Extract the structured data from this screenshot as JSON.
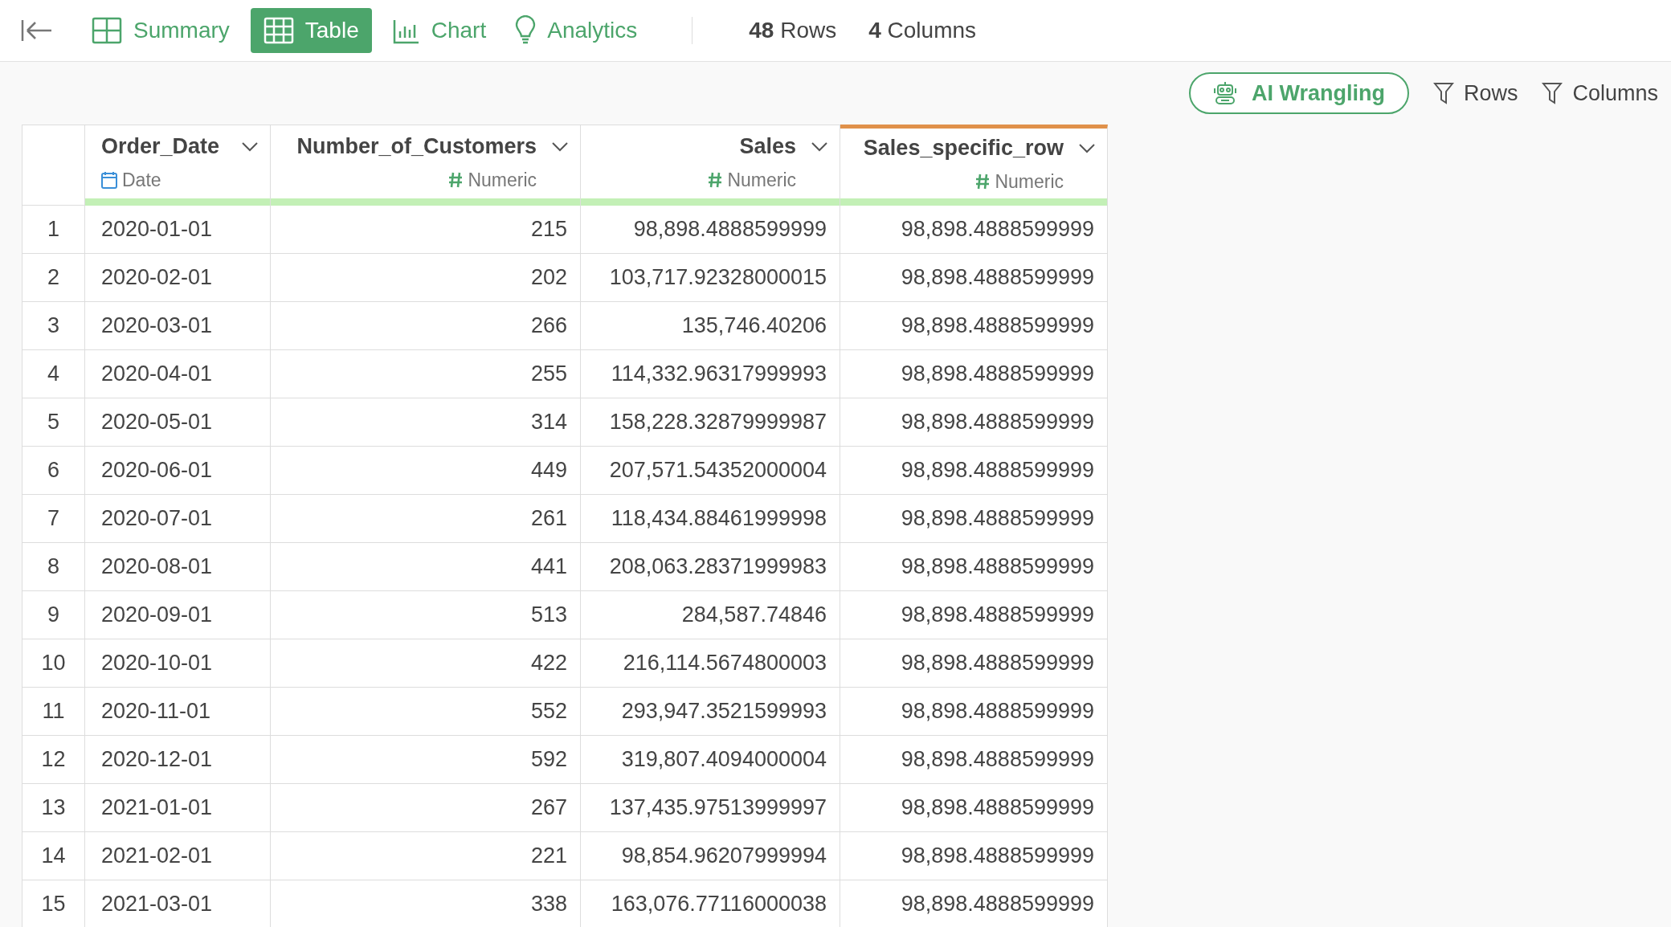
{
  "tabs": [
    {
      "label": "Summary",
      "kind": "summary",
      "selected": false
    },
    {
      "label": "Table",
      "kind": "table",
      "selected": true
    },
    {
      "label": "Chart",
      "kind": "chart",
      "selected": false
    },
    {
      "label": "Analytics",
      "kind": "analytics",
      "selected": false
    }
  ],
  "stats": [
    "**48** Rows",
    "**4** Columns"
  ],
  "toolbar": {
    "ai_button": "AI Wrangling",
    "filters": [
      "Rows",
      "Columns"
    ]
  },
  "table": {
    "columns": [
      {
        "name": "Order_Date",
        "type": "Date",
        "kind": "date",
        "selected": false
      },
      {
        "name": "Number_of_Customers",
        "type": "Numeric",
        "kind": "numeric",
        "selected": false
      },
      {
        "name": "Sales",
        "type": "Numeric",
        "kind": "numeric",
        "selected": false
      },
      {
        "name": "Sales_specific_row",
        "type": "Numeric",
        "kind": "numeric",
        "selected": true
      }
    ],
    "rows": [
      {
        "number": "1",
        "cells": [
          "2020-01-01",
          "215",
          "98,898.4888599999",
          "98,898.4888599999"
        ]
      },
      {
        "number": "2",
        "cells": [
          "2020-02-01",
          "202",
          "103,717.92328000015",
          "98,898.4888599999"
        ]
      },
      {
        "number": "3",
        "cells": [
          "2020-03-01",
          "266",
          "135,746.40206",
          "98,898.4888599999"
        ]
      },
      {
        "number": "4",
        "cells": [
          "2020-04-01",
          "255",
          "114,332.96317999993",
          "98,898.4888599999"
        ]
      },
      {
        "number": "5",
        "cells": [
          "2020-05-01",
          "314",
          "158,228.32879999987",
          "98,898.4888599999"
        ]
      },
      {
        "number": "6",
        "cells": [
          "2020-06-01",
          "449",
          "207,571.54352000004",
          "98,898.4888599999"
        ]
      },
      {
        "number": "7",
        "cells": [
          "2020-07-01",
          "261",
          "118,434.88461999998",
          "98,898.4888599999"
        ]
      },
      {
        "number": "8",
        "cells": [
          "2020-08-01",
          "441",
          "208,063.28371999983",
          "98,898.4888599999"
        ]
      },
      {
        "number": "9",
        "cells": [
          "2020-09-01",
          "513",
          "284,587.74846",
          "98,898.4888599999"
        ]
      },
      {
        "number": "10",
        "cells": [
          "2020-10-01",
          "422",
          "216,114.5674800003",
          "98,898.4888599999"
        ]
      },
      {
        "number": "11",
        "cells": [
          "2020-11-01",
          "552",
          "293,947.3521599993",
          "98,898.4888599999"
        ]
      },
      {
        "number": "12",
        "cells": [
          "2020-12-01",
          "592",
          "319,807.4094000004",
          "98,898.4888599999"
        ]
      },
      {
        "number": "13",
        "cells": [
          "2021-01-01",
          "267",
          "137,435.97513999997",
          "98,898.4888599999"
        ]
      },
      {
        "number": "14",
        "cells": [
          "2021-02-01",
          "221",
          "98,854.96207999994",
          "98,898.4888599999"
        ]
      },
      {
        "number": "15",
        "cells": [
          "2021-03-01",
          "338",
          "163,076.77116000038",
          "98,898.4888599999"
        ]
      }
    ]
  }
}
